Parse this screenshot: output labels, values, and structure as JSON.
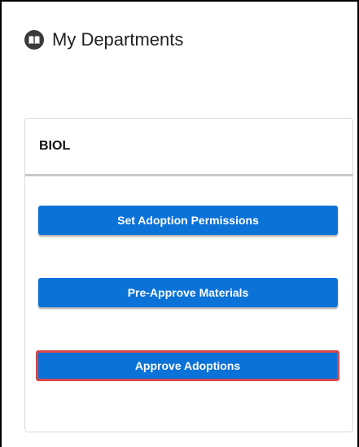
{
  "header": {
    "title": "My Departments",
    "icon": "book-icon"
  },
  "department": {
    "name": "BIOL",
    "buttons": [
      {
        "label": "Set Adoption Permissions"
      },
      {
        "label": "Pre-Approve Materials"
      },
      {
        "label": "Approve Adoptions",
        "highlighted": true
      }
    ]
  },
  "colors": {
    "button_blue": "#0b72d8",
    "highlight_red": "#d9474c",
    "icon_dark": "#3a3a3a"
  }
}
